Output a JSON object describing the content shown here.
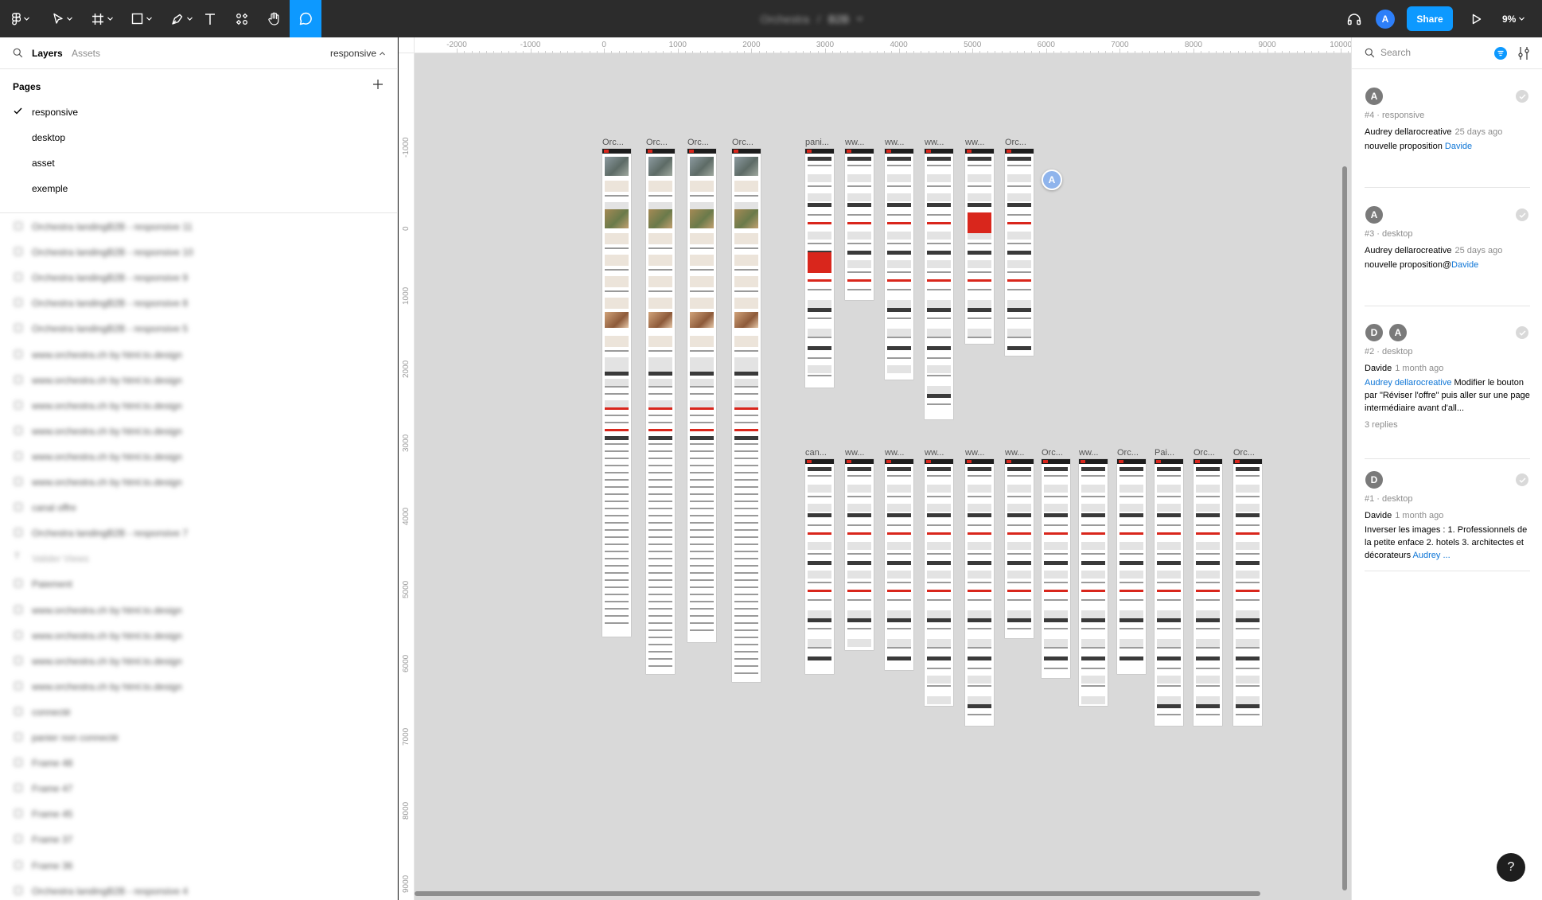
{
  "toolbar": {
    "doc_project": "Orchestra",
    "doc_separator": "/",
    "doc_file": "B2B",
    "avatar_initial": "A",
    "share_label": "Share",
    "zoom": "9%"
  },
  "left_panel": {
    "tab_layers": "Layers",
    "tab_assets": "Assets",
    "current_page": "responsive",
    "pages_header": "Pages",
    "pages": [
      "responsive",
      "desktop",
      "asset",
      "exemple"
    ],
    "layers": [
      "Orchestra landingB2B - responsive 11",
      "Orchestra landingB2B - responsive 10",
      "Orchestra landingB2B - responsive 9",
      "Orchestra landingB2B - responsive 8",
      "Orchestra landingB2B - responsive 5",
      "www.orchestra.ch by html.to.design",
      "www.orchestra.ch by html.to.design",
      "www.orchestra.ch by html.to.design",
      "www.orchestra.ch by html.to.design",
      "www.orchestra.ch by html.to.design",
      "www.orchestra.ch by html.to.design",
      "canal offre",
      "Orchestra landingB2B - responsive 7",
      "Valider Views",
      "Paiement",
      "www.orchestra.ch by html.to.design",
      "www.orchestra.ch by html.to.design",
      "www.orchestra.ch by html.to.design",
      "www.orchestra.ch by html.to.design",
      "connecté",
      "panier non connecté",
      "Frame 48",
      "Frame 47",
      "Frame 45",
      "Frame 37",
      "Frame 36",
      "Orchestra landingB2B - responsive 4"
    ]
  },
  "canvas": {
    "ruler_x": [
      "-2000",
      "-1000",
      "0",
      "1000",
      "2000",
      "3000",
      "4000",
      "5000",
      "6000",
      "7000",
      "8000",
      "9000",
      "10000"
    ],
    "ruler_y": [
      "-1000",
      "0",
      "1000",
      "2000",
      "3000",
      "4000",
      "5000",
      "6000",
      "7000",
      "8000",
      "9000"
    ],
    "frame_labels_top": [
      "Orc...",
      "Orc...",
      "Orc...",
      "Orc...",
      "pani...",
      "ww...",
      "ww...",
      "ww...",
      "ww...",
      "Orc..."
    ],
    "frame_labels_bottom": [
      "can...",
      "ww...",
      "ww...",
      "ww...",
      "ww...",
      "ww...",
      "Orc...",
      "ww...",
      "Orc...",
      "Pai...",
      "Orc...",
      "Orc..."
    ],
    "comment_pin": "A"
  },
  "right_panel": {
    "search_placeholder": "Search",
    "comments": [
      {
        "avatars": [
          "A"
        ],
        "meta": "#4 · responsive",
        "author": "Audrey dellarocreative",
        "time": "25 days ago",
        "body": "nouvelle proposition ",
        "mention": "Davide",
        "replies": ""
      },
      {
        "avatars": [
          "A"
        ],
        "meta": "#3 · desktop",
        "author": "Audrey dellarocreative",
        "time": "25 days ago",
        "body": "nouvelle proposition@",
        "mention": "Davide",
        "replies": ""
      },
      {
        "avatars": [
          "D",
          "A"
        ],
        "meta": "#2 · desktop",
        "author": "Davide",
        "time": "1 month ago",
        "mention_lead": "Audrey dellarocreative",
        "body": " Modifier le bouton par \"Réviser l'offre\" puis aller sur une page intermédiaire avant d'all...",
        "replies": "3 replies"
      },
      {
        "avatars": [
          "D"
        ],
        "meta": "#1 · desktop",
        "author": "Davide",
        "time": "1 month ago",
        "body": "Inverser les images : 1. Professionnels de la petite enface 2. hotels 3. architectes et décorateurs ",
        "mention": "Audrey ...",
        "replies": ""
      }
    ],
    "help_label": "?"
  },
  "colors": {
    "toolbar_bg": "#2c2c2c",
    "accent": "#0d99ff",
    "canvas_bg": "#d9d9d9",
    "brand_red": "#d9261c"
  }
}
